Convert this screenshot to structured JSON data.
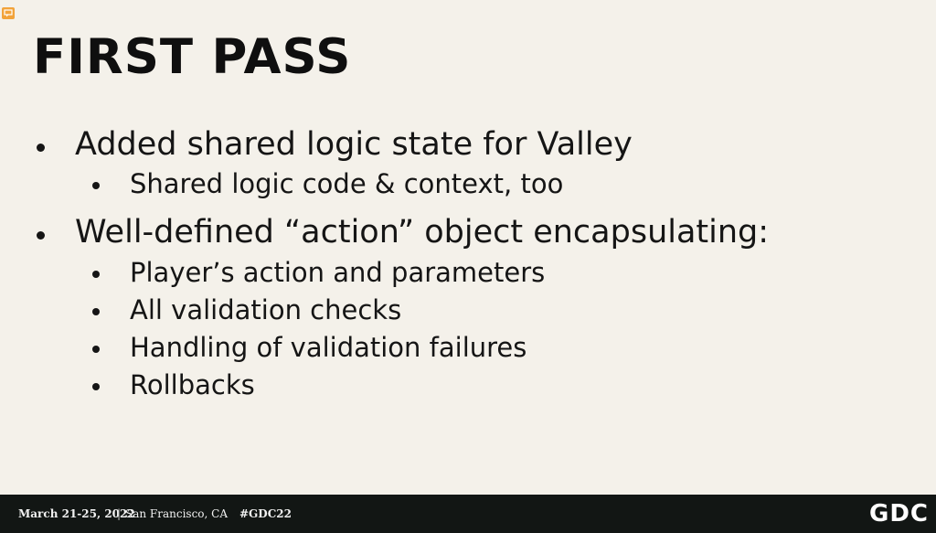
{
  "slide": {
    "title": "FIRST PASS",
    "bullets": [
      {
        "text": "Added shared logic state for Valley",
        "sub": [
          "Shared logic code & context, too"
        ]
      },
      {
        "text": "Well-defined “action” object encapsulating:",
        "sub": [
          "Player’s action and parameters",
          "All validation checks",
          "Handling of validation failures",
          "Rollbacks"
        ]
      }
    ]
  },
  "footer": {
    "date": "March 21-25, 2022",
    "separator": "|",
    "location": "San Francisco, CA",
    "hashtag": "#GDC22",
    "logo_text": "GDC"
  },
  "icons": {
    "corner": "chat-icon"
  },
  "colors": {
    "background": "#f4f1ea",
    "text": "#151515",
    "footer_bg": "#121614",
    "icon_accent": "#f2a33a"
  }
}
